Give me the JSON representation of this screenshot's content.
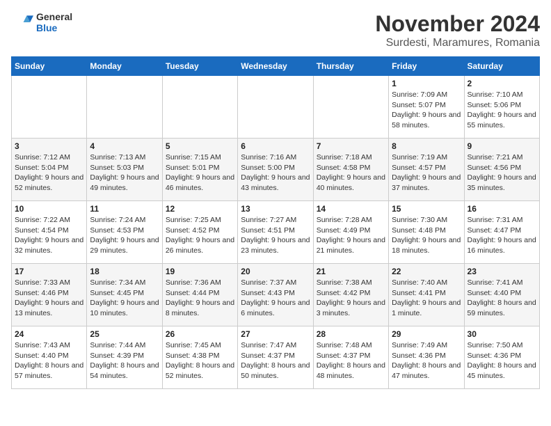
{
  "logo": {
    "general": "General",
    "blue": "Blue"
  },
  "title": "November 2024",
  "location": "Surdesti, Maramures, Romania",
  "days_of_week": [
    "Sunday",
    "Monday",
    "Tuesday",
    "Wednesday",
    "Thursday",
    "Friday",
    "Saturday"
  ],
  "weeks": [
    [
      null,
      null,
      null,
      null,
      null,
      {
        "day": "1",
        "sunrise": "Sunrise: 7:09 AM",
        "sunset": "Sunset: 5:07 PM",
        "daylight": "Daylight: 9 hours and 58 minutes."
      },
      {
        "day": "2",
        "sunrise": "Sunrise: 7:10 AM",
        "sunset": "Sunset: 5:06 PM",
        "daylight": "Daylight: 9 hours and 55 minutes."
      }
    ],
    [
      {
        "day": "3",
        "sunrise": "Sunrise: 7:12 AM",
        "sunset": "Sunset: 5:04 PM",
        "daylight": "Daylight: 9 hours and 52 minutes."
      },
      {
        "day": "4",
        "sunrise": "Sunrise: 7:13 AM",
        "sunset": "Sunset: 5:03 PM",
        "daylight": "Daylight: 9 hours and 49 minutes."
      },
      {
        "day": "5",
        "sunrise": "Sunrise: 7:15 AM",
        "sunset": "Sunset: 5:01 PM",
        "daylight": "Daylight: 9 hours and 46 minutes."
      },
      {
        "day": "6",
        "sunrise": "Sunrise: 7:16 AM",
        "sunset": "Sunset: 5:00 PM",
        "daylight": "Daylight: 9 hours and 43 minutes."
      },
      {
        "day": "7",
        "sunrise": "Sunrise: 7:18 AM",
        "sunset": "Sunset: 4:58 PM",
        "daylight": "Daylight: 9 hours and 40 minutes."
      },
      {
        "day": "8",
        "sunrise": "Sunrise: 7:19 AM",
        "sunset": "Sunset: 4:57 PM",
        "daylight": "Daylight: 9 hours and 37 minutes."
      },
      {
        "day": "9",
        "sunrise": "Sunrise: 7:21 AM",
        "sunset": "Sunset: 4:56 PM",
        "daylight": "Daylight: 9 hours and 35 minutes."
      }
    ],
    [
      {
        "day": "10",
        "sunrise": "Sunrise: 7:22 AM",
        "sunset": "Sunset: 4:54 PM",
        "daylight": "Daylight: 9 hours and 32 minutes."
      },
      {
        "day": "11",
        "sunrise": "Sunrise: 7:24 AM",
        "sunset": "Sunset: 4:53 PM",
        "daylight": "Daylight: 9 hours and 29 minutes."
      },
      {
        "day": "12",
        "sunrise": "Sunrise: 7:25 AM",
        "sunset": "Sunset: 4:52 PM",
        "daylight": "Daylight: 9 hours and 26 minutes."
      },
      {
        "day": "13",
        "sunrise": "Sunrise: 7:27 AM",
        "sunset": "Sunset: 4:51 PM",
        "daylight": "Daylight: 9 hours and 23 minutes."
      },
      {
        "day": "14",
        "sunrise": "Sunrise: 7:28 AM",
        "sunset": "Sunset: 4:49 PM",
        "daylight": "Daylight: 9 hours and 21 minutes."
      },
      {
        "day": "15",
        "sunrise": "Sunrise: 7:30 AM",
        "sunset": "Sunset: 4:48 PM",
        "daylight": "Daylight: 9 hours and 18 minutes."
      },
      {
        "day": "16",
        "sunrise": "Sunrise: 7:31 AM",
        "sunset": "Sunset: 4:47 PM",
        "daylight": "Daylight: 9 hours and 16 minutes."
      }
    ],
    [
      {
        "day": "17",
        "sunrise": "Sunrise: 7:33 AM",
        "sunset": "Sunset: 4:46 PM",
        "daylight": "Daylight: 9 hours and 13 minutes."
      },
      {
        "day": "18",
        "sunrise": "Sunrise: 7:34 AM",
        "sunset": "Sunset: 4:45 PM",
        "daylight": "Daylight: 9 hours and 10 minutes."
      },
      {
        "day": "19",
        "sunrise": "Sunrise: 7:36 AM",
        "sunset": "Sunset: 4:44 PM",
        "daylight": "Daylight: 9 hours and 8 minutes."
      },
      {
        "day": "20",
        "sunrise": "Sunrise: 7:37 AM",
        "sunset": "Sunset: 4:43 PM",
        "daylight": "Daylight: 9 hours and 6 minutes."
      },
      {
        "day": "21",
        "sunrise": "Sunrise: 7:38 AM",
        "sunset": "Sunset: 4:42 PM",
        "daylight": "Daylight: 9 hours and 3 minutes."
      },
      {
        "day": "22",
        "sunrise": "Sunrise: 7:40 AM",
        "sunset": "Sunset: 4:41 PM",
        "daylight": "Daylight: 9 hours and 1 minute."
      },
      {
        "day": "23",
        "sunrise": "Sunrise: 7:41 AM",
        "sunset": "Sunset: 4:40 PM",
        "daylight": "Daylight: 8 hours and 59 minutes."
      }
    ],
    [
      {
        "day": "24",
        "sunrise": "Sunrise: 7:43 AM",
        "sunset": "Sunset: 4:40 PM",
        "daylight": "Daylight: 8 hours and 57 minutes."
      },
      {
        "day": "25",
        "sunrise": "Sunrise: 7:44 AM",
        "sunset": "Sunset: 4:39 PM",
        "daylight": "Daylight: 8 hours and 54 minutes."
      },
      {
        "day": "26",
        "sunrise": "Sunrise: 7:45 AM",
        "sunset": "Sunset: 4:38 PM",
        "daylight": "Daylight: 8 hours and 52 minutes."
      },
      {
        "day": "27",
        "sunrise": "Sunrise: 7:47 AM",
        "sunset": "Sunset: 4:37 PM",
        "daylight": "Daylight: 8 hours and 50 minutes."
      },
      {
        "day": "28",
        "sunrise": "Sunrise: 7:48 AM",
        "sunset": "Sunset: 4:37 PM",
        "daylight": "Daylight: 8 hours and 48 minutes."
      },
      {
        "day": "29",
        "sunrise": "Sunrise: 7:49 AM",
        "sunset": "Sunset: 4:36 PM",
        "daylight": "Daylight: 8 hours and 47 minutes."
      },
      {
        "day": "30",
        "sunrise": "Sunrise: 7:50 AM",
        "sunset": "Sunset: 4:36 PM",
        "daylight": "Daylight: 8 hours and 45 minutes."
      }
    ]
  ]
}
